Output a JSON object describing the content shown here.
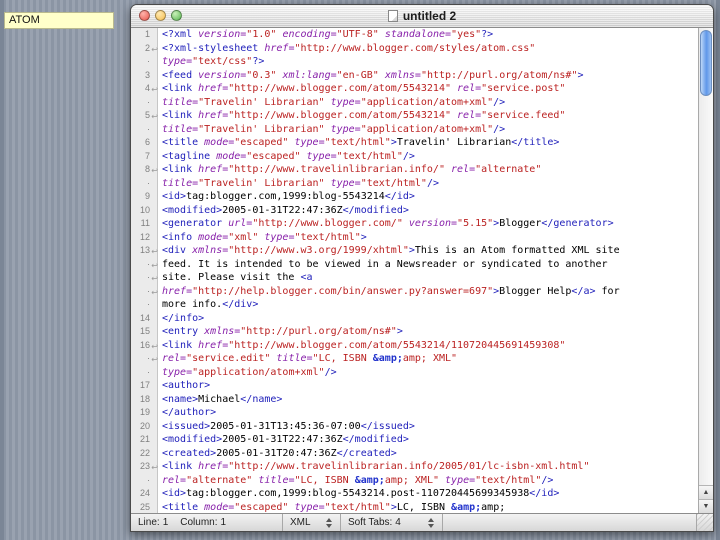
{
  "background_label": {
    "text": "ATOM"
  },
  "window": {
    "title": "untitled 2",
    "scrollbar": {
      "up_icon": "▲",
      "down_icon": "▼"
    },
    "statusbar": {
      "line_label": "Line:",
      "line_value": "1",
      "column_label": "Column:",
      "column_value": "1",
      "mode": "XML",
      "tabs_label": "Soft Tabs:",
      "tabs_value": "4"
    },
    "editor": {
      "wrap_icon": "↩",
      "continuation_mark": "·",
      "token_colors": {
        "tag": "#2222bb",
        "attr": "#8822aa",
        "value": "#bb2222",
        "text": "#000000",
        "entity": "#2233cc"
      },
      "rows": [
        {
          "num": "1",
          "tokens": [
            [
              "t",
              "<?xml "
            ],
            [
              "a",
              "version="
            ],
            [
              "v",
              "\"1.0\""
            ],
            [
              "x",
              " "
            ],
            [
              "a",
              "encoding="
            ],
            [
              "v",
              "\"UTF-8\""
            ],
            [
              "x",
              " "
            ],
            [
              "a",
              "standalone="
            ],
            [
              "v",
              "\"yes\""
            ],
            [
              "t",
              "?>"
            ]
          ]
        },
        {
          "num": "2",
          "tokens": [
            [
              "t",
              "<?xml-stylesheet "
            ],
            [
              "a",
              "href="
            ],
            [
              "v",
              "\"http://www.blogger.com/styles/atom.css\""
            ]
          ]
        },
        {
          "num": "·",
          "tokens": [
            [
              "a",
              "type="
            ],
            [
              "v",
              "\"text/css\""
            ],
            [
              "t",
              "?>"
            ]
          ]
        },
        {
          "num": "3",
          "tokens": [
            [
              "t",
              "<feed "
            ],
            [
              "a",
              "version="
            ],
            [
              "v",
              "\"0.3\""
            ],
            [
              "x",
              " "
            ],
            [
              "a",
              "xml:lang="
            ],
            [
              "v",
              "\"en-GB\""
            ],
            [
              "x",
              " "
            ],
            [
              "a",
              "xmlns="
            ],
            [
              "v",
              "\"http://purl.org/atom/ns#\""
            ],
            [
              "t",
              ">"
            ]
          ]
        },
        {
          "num": "4",
          "tokens": [
            [
              "t",
              "<link "
            ],
            [
              "a",
              "href="
            ],
            [
              "v",
              "\"http://www.blogger.com/atom/5543214\""
            ],
            [
              "x",
              " "
            ],
            [
              "a",
              "rel="
            ],
            [
              "v",
              "\"service.post\""
            ]
          ]
        },
        {
          "num": "·",
          "tokens": [
            [
              "a",
              "title="
            ],
            [
              "v",
              "\"Travelin' Librarian\""
            ],
            [
              "x",
              " "
            ],
            [
              "a",
              "type="
            ],
            [
              "v",
              "\"application/atom+xml\""
            ],
            [
              "t",
              "/>"
            ]
          ]
        },
        {
          "num": "5",
          "tokens": [
            [
              "t",
              "<link "
            ],
            [
              "a",
              "href="
            ],
            [
              "v",
              "\"http://www.blogger.com/atom/5543214\""
            ],
            [
              "x",
              " "
            ],
            [
              "a",
              "rel="
            ],
            [
              "v",
              "\"service.feed\""
            ]
          ]
        },
        {
          "num": "·",
          "tokens": [
            [
              "a",
              "title="
            ],
            [
              "v",
              "\"Travelin' Librarian\""
            ],
            [
              "x",
              " "
            ],
            [
              "a",
              "type="
            ],
            [
              "v",
              "\"application/atom+xml\""
            ],
            [
              "t",
              "/>"
            ]
          ]
        },
        {
          "num": "6",
          "tokens": [
            [
              "t",
              "<title "
            ],
            [
              "a",
              "mode="
            ],
            [
              "v",
              "\"escaped\""
            ],
            [
              "x",
              " "
            ],
            [
              "a",
              "type="
            ],
            [
              "v",
              "\"text/html\""
            ],
            [
              "t",
              ">"
            ],
            [
              "x",
              "Travelin' Librarian"
            ],
            [
              "t",
              "</title>"
            ]
          ]
        },
        {
          "num": "7",
          "tokens": [
            [
              "t",
              "<tagline "
            ],
            [
              "a",
              "mode="
            ],
            [
              "v",
              "\"escaped\""
            ],
            [
              "x",
              " "
            ],
            [
              "a",
              "type="
            ],
            [
              "v",
              "\"text/html\""
            ],
            [
              "t",
              "/>"
            ]
          ]
        },
        {
          "num": "8",
          "tokens": [
            [
              "t",
              "<link "
            ],
            [
              "a",
              "href="
            ],
            [
              "v",
              "\"http://www.travelinlibrarian.info/\""
            ],
            [
              "x",
              " "
            ],
            [
              "a",
              "rel="
            ],
            [
              "v",
              "\"alternate\""
            ]
          ]
        },
        {
          "num": "·",
          "tokens": [
            [
              "a",
              "title="
            ],
            [
              "v",
              "\"Travelin' Librarian\""
            ],
            [
              "x",
              " "
            ],
            [
              "a",
              "type="
            ],
            [
              "v",
              "\"text/html\""
            ],
            [
              "t",
              "/>"
            ]
          ]
        },
        {
          "num": "9",
          "tokens": [
            [
              "t",
              "<id>"
            ],
            [
              "x",
              "tag:blogger.com,1999:blog-5543214"
            ],
            [
              "t",
              "</id>"
            ]
          ]
        },
        {
          "num": "10",
          "tokens": [
            [
              "t",
              "<modified>"
            ],
            [
              "x",
              "2005-01-31T22:47:36Z"
            ],
            [
              "t",
              "</modified>"
            ]
          ]
        },
        {
          "num": "11",
          "tokens": [
            [
              "t",
              "<generator "
            ],
            [
              "a",
              "url="
            ],
            [
              "v",
              "\"http://www.blogger.com/\""
            ],
            [
              "x",
              " "
            ],
            [
              "a",
              "version="
            ],
            [
              "v",
              "\"5.15\""
            ],
            [
              "t",
              ">"
            ],
            [
              "x",
              "Blogger"
            ],
            [
              "t",
              "</generator>"
            ]
          ]
        },
        {
          "num": "12",
          "tokens": [
            [
              "t",
              "<info "
            ],
            [
              "a",
              "mode="
            ],
            [
              "v",
              "\"xml\""
            ],
            [
              "x",
              " "
            ],
            [
              "a",
              "type="
            ],
            [
              "v",
              "\"text/html\""
            ],
            [
              "t",
              ">"
            ]
          ]
        },
        {
          "num": "13",
          "tokens": [
            [
              "t",
              "<div "
            ],
            [
              "a",
              "xmlns="
            ],
            [
              "v",
              "\"http://www.w3.org/1999/xhtml\""
            ],
            [
              "t",
              ">"
            ],
            [
              "x",
              "This is an Atom formatted XML site"
            ]
          ]
        },
        {
          "num": "·",
          "tokens": [
            [
              "x",
              "feed. It is intended to be viewed in a Newsreader or syndicated to another"
            ]
          ]
        },
        {
          "num": "·",
          "tokens": [
            [
              "x",
              "site. Please visit the "
            ],
            [
              "t",
              "<a"
            ]
          ]
        },
        {
          "num": "·",
          "tokens": [
            [
              "a",
              "href="
            ],
            [
              "v",
              "\"http://help.blogger.com/bin/answer.py?answer=697\""
            ],
            [
              "t",
              ">"
            ],
            [
              "x",
              "Blogger Help"
            ],
            [
              "t",
              "</a>"
            ],
            [
              "x",
              " for"
            ]
          ]
        },
        {
          "num": "·",
          "tokens": [
            [
              "x",
              "more info."
            ],
            [
              "t",
              "</div>"
            ]
          ]
        },
        {
          "num": "14",
          "tokens": [
            [
              "t",
              "</info>"
            ]
          ]
        },
        {
          "num": "15",
          "tokens": [
            [
              "t",
              "<entry "
            ],
            [
              "a",
              "xmlns="
            ],
            [
              "v",
              "\"http://purl.org/atom/ns#\""
            ],
            [
              "t",
              ">"
            ]
          ]
        },
        {
          "num": "16",
          "tokens": [
            [
              "t",
              "<link "
            ],
            [
              "a",
              "href="
            ],
            [
              "v",
              "\"http://www.blogger.com/atom/5543214/110720445691459308\""
            ]
          ]
        },
        {
          "num": "·",
          "tokens": [
            [
              "a",
              "rel="
            ],
            [
              "v",
              "\"service.edit\""
            ],
            [
              "x",
              " "
            ],
            [
              "a",
              "title="
            ],
            [
              "v",
              "\"LC, ISBN "
            ],
            [
              "e",
              "&amp;"
            ],
            [
              "v",
              "amp; XML\""
            ]
          ]
        },
        {
          "num": "·",
          "tokens": [
            [
              "a",
              "type="
            ],
            [
              "v",
              "\"application/atom+xml\""
            ],
            [
              "t",
              "/>"
            ]
          ]
        },
        {
          "num": "17",
          "tokens": [
            [
              "t",
              "<author>"
            ]
          ]
        },
        {
          "num": "18",
          "tokens": [
            [
              "t",
              "<name>"
            ],
            [
              "x",
              "Michael"
            ],
            [
              "t",
              "</name>"
            ]
          ]
        },
        {
          "num": "19",
          "tokens": [
            [
              "t",
              "</author>"
            ]
          ]
        },
        {
          "num": "20",
          "tokens": [
            [
              "t",
              "<issued>"
            ],
            [
              "x",
              "2005-01-31T13:45:36-07:00"
            ],
            [
              "t",
              "</issued>"
            ]
          ]
        },
        {
          "num": "21",
          "tokens": [
            [
              "t",
              "<modified>"
            ],
            [
              "x",
              "2005-01-31T22:47:36Z"
            ],
            [
              "t",
              "</modified>"
            ]
          ]
        },
        {
          "num": "22",
          "tokens": [
            [
              "t",
              "<created>"
            ],
            [
              "x",
              "2005-01-31T20:47:36Z"
            ],
            [
              "t",
              "</created>"
            ]
          ]
        },
        {
          "num": "23",
          "tokens": [
            [
              "t",
              "<link "
            ],
            [
              "a",
              "href="
            ],
            [
              "v",
              "\"http://www.travelinlibrarian.info/2005/01/lc-isbn-xml.html\""
            ]
          ]
        },
        {
          "num": "·",
          "tokens": [
            [
              "a",
              "rel="
            ],
            [
              "v",
              "\"alternate\""
            ],
            [
              "x",
              " "
            ],
            [
              "a",
              "title="
            ],
            [
              "v",
              "\"LC, ISBN "
            ],
            [
              "e",
              "&amp;"
            ],
            [
              "v",
              "amp; XML\""
            ],
            [
              "x",
              " "
            ],
            [
              "a",
              "type="
            ],
            [
              "v",
              "\"text/html\""
            ],
            [
              "t",
              "/>"
            ]
          ]
        },
        {
          "num": "24",
          "tokens": [
            [
              "t",
              "<id>"
            ],
            [
              "x",
              "tag:blogger.com,1999:blog-5543214.post-110720445699345938"
            ],
            [
              "t",
              "</id>"
            ]
          ]
        },
        {
          "num": "25",
          "tokens": [
            [
              "t",
              "<title "
            ],
            [
              "a",
              "mode="
            ],
            [
              "v",
              "\"escaped\""
            ],
            [
              "x",
              " "
            ],
            [
              "a",
              "type="
            ],
            [
              "v",
              "\"text/html\""
            ],
            [
              "t",
              ">"
            ],
            [
              "x",
              "LC, ISBN "
            ],
            [
              "e",
              "&amp;"
            ],
            [
              "x",
              "amp;"
            ]
          ]
        }
      ]
    }
  }
}
